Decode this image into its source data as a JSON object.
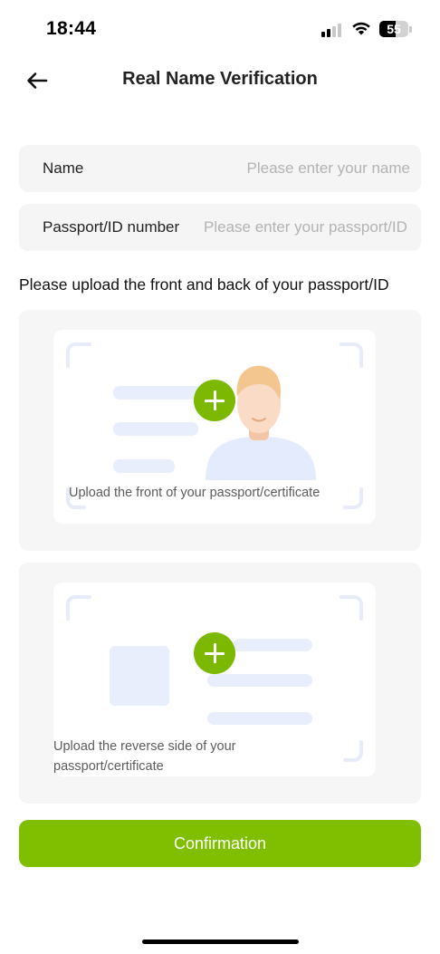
{
  "status_bar": {
    "time": "18:44",
    "battery_level": "55",
    "icons": [
      "cellular-signal-icon",
      "wifi-icon",
      "battery-icon"
    ]
  },
  "header": {
    "back_icon": "arrow-left-icon",
    "title": "Real Name Verification"
  },
  "form": {
    "name": {
      "label": "Name",
      "placeholder": "Please enter your name",
      "value": ""
    },
    "passport": {
      "label": "Passport/ID number",
      "placeholder": "Please enter your passport/ID number",
      "value": ""
    }
  },
  "upload": {
    "hint": "Please upload the front and back of your passport/ID",
    "front": {
      "caption": "Upload the front of your passport/certificate",
      "icon": "plus-icon"
    },
    "back": {
      "caption": "Upload the reverse side of your passport/certificate",
      "icon": "plus-icon"
    }
  },
  "actions": {
    "confirm_label": "Confirmation"
  },
  "colors": {
    "accent": "#7fbf00",
    "field_background": "#f5f5f5",
    "placeholder_illustration": "#e8eefb"
  }
}
